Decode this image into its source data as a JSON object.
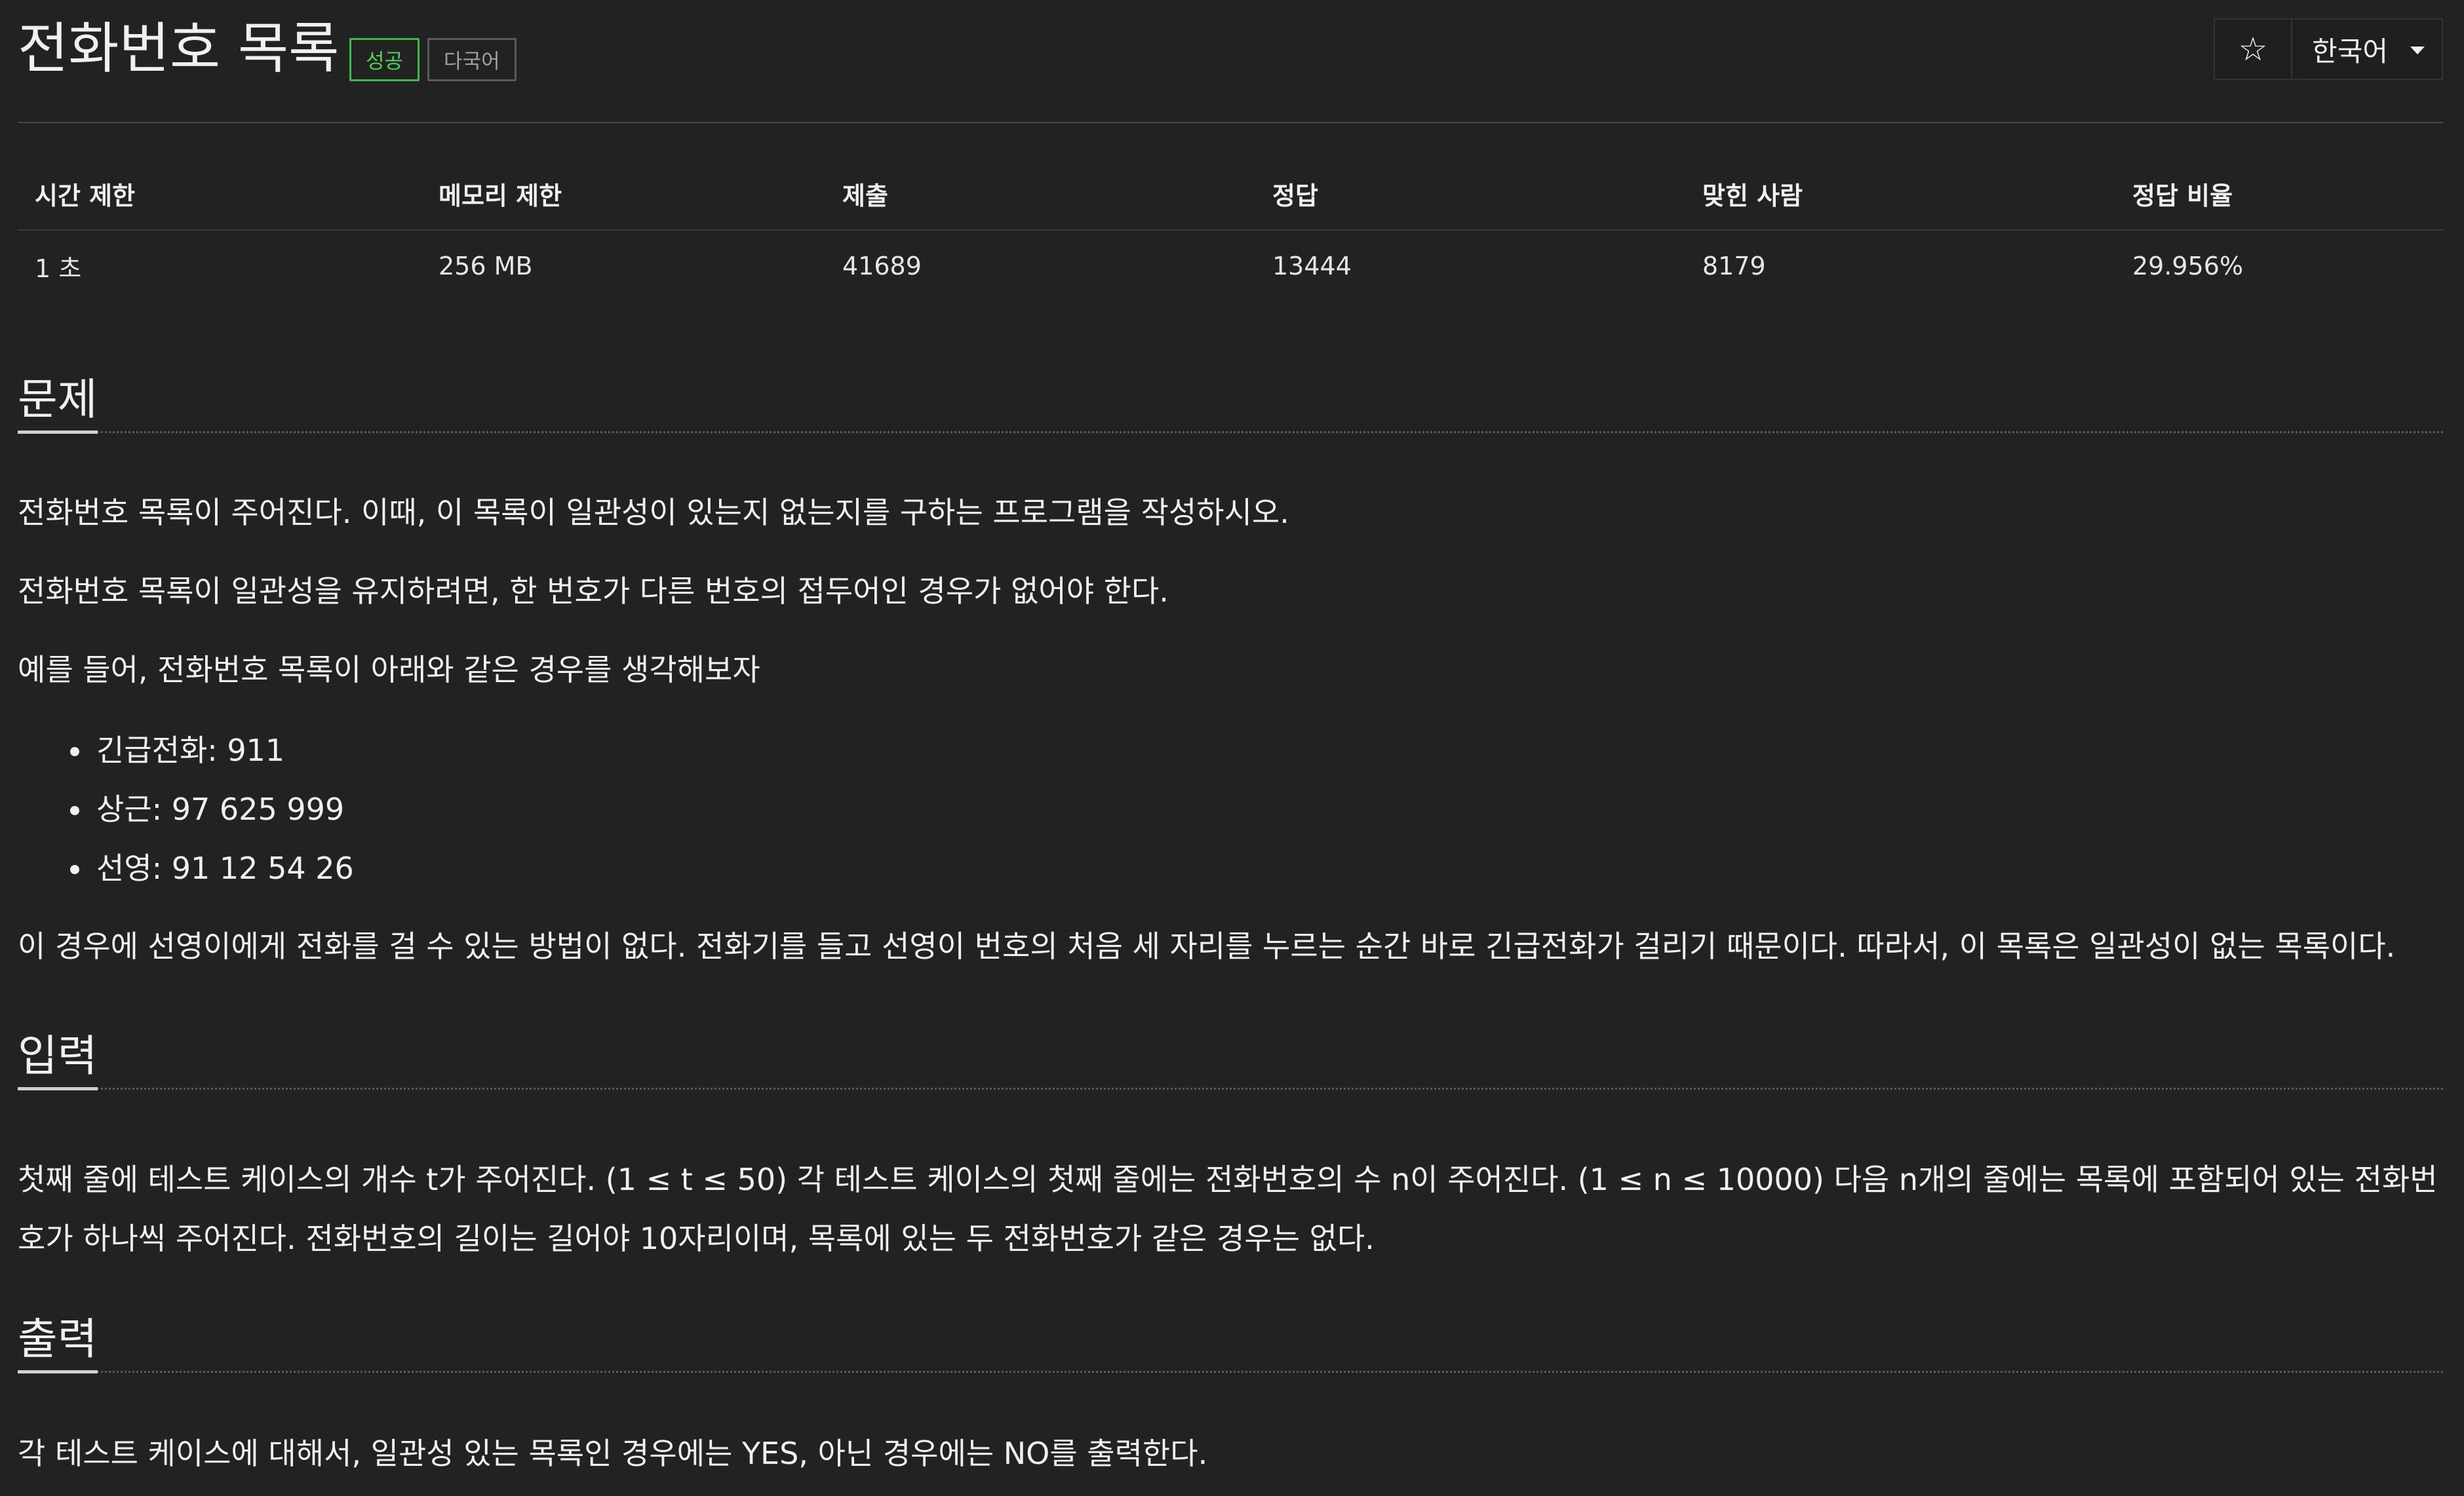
{
  "header": {
    "title": "전화번호 목록",
    "badges": {
      "success": "성공",
      "multilang": "다국어"
    },
    "star_glyph": "☆",
    "language": "한국어"
  },
  "info": {
    "headers": [
      "시간 제한",
      "메모리 제한",
      "제출",
      "정답",
      "맞힌 사람",
      "정답 비율"
    ],
    "values": [
      "1 초",
      "256 MB",
      "41689",
      "13444",
      "8179",
      "29.956%"
    ]
  },
  "problem": {
    "heading": "문제",
    "paragraphs": [
      "전화번호 목록이 주어진다. 이때, 이 목록이 일관성이 있는지 없는지를 구하는 프로그램을 작성하시오.",
      "전화번호 목록이 일관성을 유지하려면, 한 번호가 다른 번호의 접두어인 경우가 없어야 한다.",
      "예를 들어, 전화번호 목록이 아래와 같은 경우를 생각해보자"
    ],
    "bullets": [
      "긴급전화: 911",
      "상근: 97 625 999",
      "선영: 91 12 54 26"
    ],
    "after": "이 경우에 선영이에게 전화를 걸 수 있는 방법이 없다. 전화기를 들고 선영이 번호의 처음 세 자리를 누르는 순간 바로 긴급전화가 걸리기 때문이다. 따라서, 이 목록은 일관성이 없는 목록이다."
  },
  "input": {
    "heading": "입력",
    "text": "첫째 줄에 테스트 케이스의 개수 t가 주어진다. (1 ≤ t ≤ 50) 각 테스트 케이스의 첫째 줄에는 전화번호의 수 n이 주어진다. (1 ≤ n ≤ 10000) 다음 n개의 줄에는 목록에 포함되어 있는 전화번호가 하나씩 주어진다. 전화번호의 길이는 길어야 10자리이며, 목록에 있는 두 전화번호가 같은 경우는 없다."
  },
  "output": {
    "heading": "출력",
    "text": "각 테스트 케이스에 대해서, 일관성 있는 목록인 경우에는 YES, 아닌 경우에는 NO를 출력한다."
  }
}
